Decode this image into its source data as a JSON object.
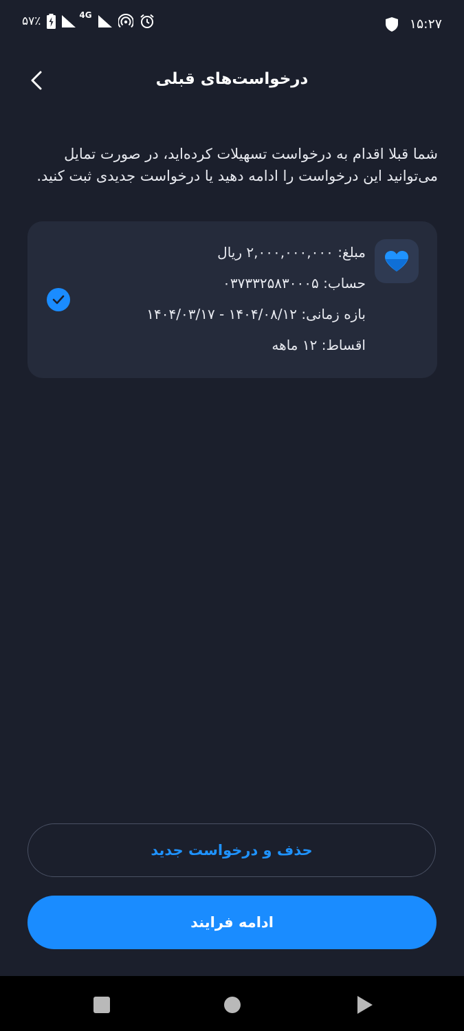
{
  "status_bar": {
    "time": "۱۵:۲۷",
    "battery": "۵۷٪",
    "network": "4G",
    "icons": [
      "battery-charging-icon",
      "signal-icon",
      "signal-icon",
      "hotspot-icon",
      "alarm-icon",
      "shield-icon"
    ]
  },
  "header": {
    "title": "درخواست‌های قبلی",
    "back_icon": "chevron-left-icon"
  },
  "intro": {
    "text": "شما قبلا اقدام به درخواست تسهیلات کرده‌اید، در صورت تمایل می‌توانید این درخواست را ادامه دهید یا درخواست جدیدی ثبت کنید."
  },
  "request_card": {
    "icon": "heart-icon",
    "amount": "مبلغ: ۲,۰۰۰,۰۰۰,۰۰۰ ریال",
    "account": "حساب: ۰۳۷۳۳۲۵۸۳۰۰۰۵",
    "period": "بازه زمانی: ۱۴۰۴/۰۸/۱۲ - ۱۴۰۴/۰۳/۱۷",
    "installments": "اقساط: ۱۲ ماهه",
    "selected": true
  },
  "actions": {
    "delete_new_label": "حذف و درخواست جدید",
    "continue_label": "ادامه فرایند"
  },
  "colors": {
    "background": "#1b1f2c",
    "card": "#252b3b",
    "accent": "#1a8cff"
  }
}
